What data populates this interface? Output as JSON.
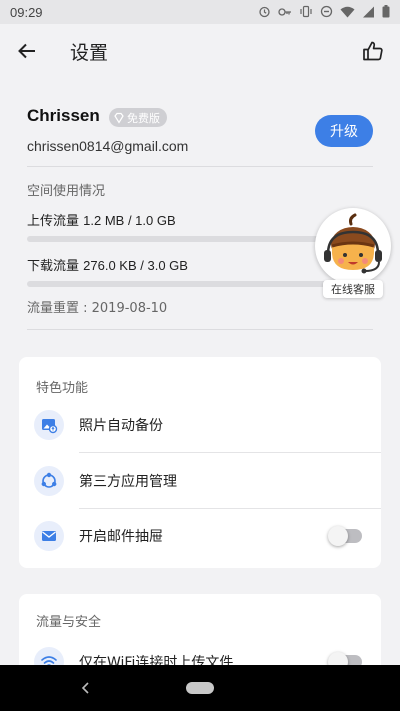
{
  "status_bar": {
    "time": "09:29",
    "icons": [
      "alarm-icon",
      "key-icon",
      "vibrate-icon",
      "minus-circle-icon",
      "wifi-icon",
      "signal-icon",
      "battery-icon"
    ]
  },
  "app_bar": {
    "title": "设置",
    "back_icon": "arrow-left-icon",
    "action_icon": "thumbs-up-icon"
  },
  "account": {
    "username": "Chrissen",
    "badge": "免费版",
    "email": "chrissen0814@gmail.com",
    "upgrade_label": "升级"
  },
  "storage": {
    "section_title": "空间使用情况",
    "upload_label": "上传流量",
    "upload_value": "1.2 MB / 1.0 GB",
    "upload_progress": 0,
    "download_label": "下载流量",
    "download_value": "276.0 KB / 3.0 GB",
    "download_progress": 0,
    "reset_label": "流量重置 : 2019-08-10"
  },
  "support": {
    "label": "在线客服"
  },
  "features": {
    "title": "特色功能",
    "items": [
      {
        "label": "照片自动备份",
        "icon": "photo-backup-icon",
        "has_toggle": false
      },
      {
        "label": "第三方应用管理",
        "icon": "app-share-icon",
        "has_toggle": false
      },
      {
        "label": "开启邮件抽屉",
        "icon": "mail-icon",
        "has_toggle": true,
        "toggle_on": false
      }
    ]
  },
  "traffic_security": {
    "title": "流量与安全",
    "items": [
      {
        "label": "仅在WiFi连接时上传文件",
        "icon": "wifi-icon",
        "has_toggle": true,
        "toggle_on": false
      }
    ]
  },
  "colors": {
    "accent": "#3d7fe6",
    "background": "#f2f2f4",
    "card": "#ffffff"
  }
}
